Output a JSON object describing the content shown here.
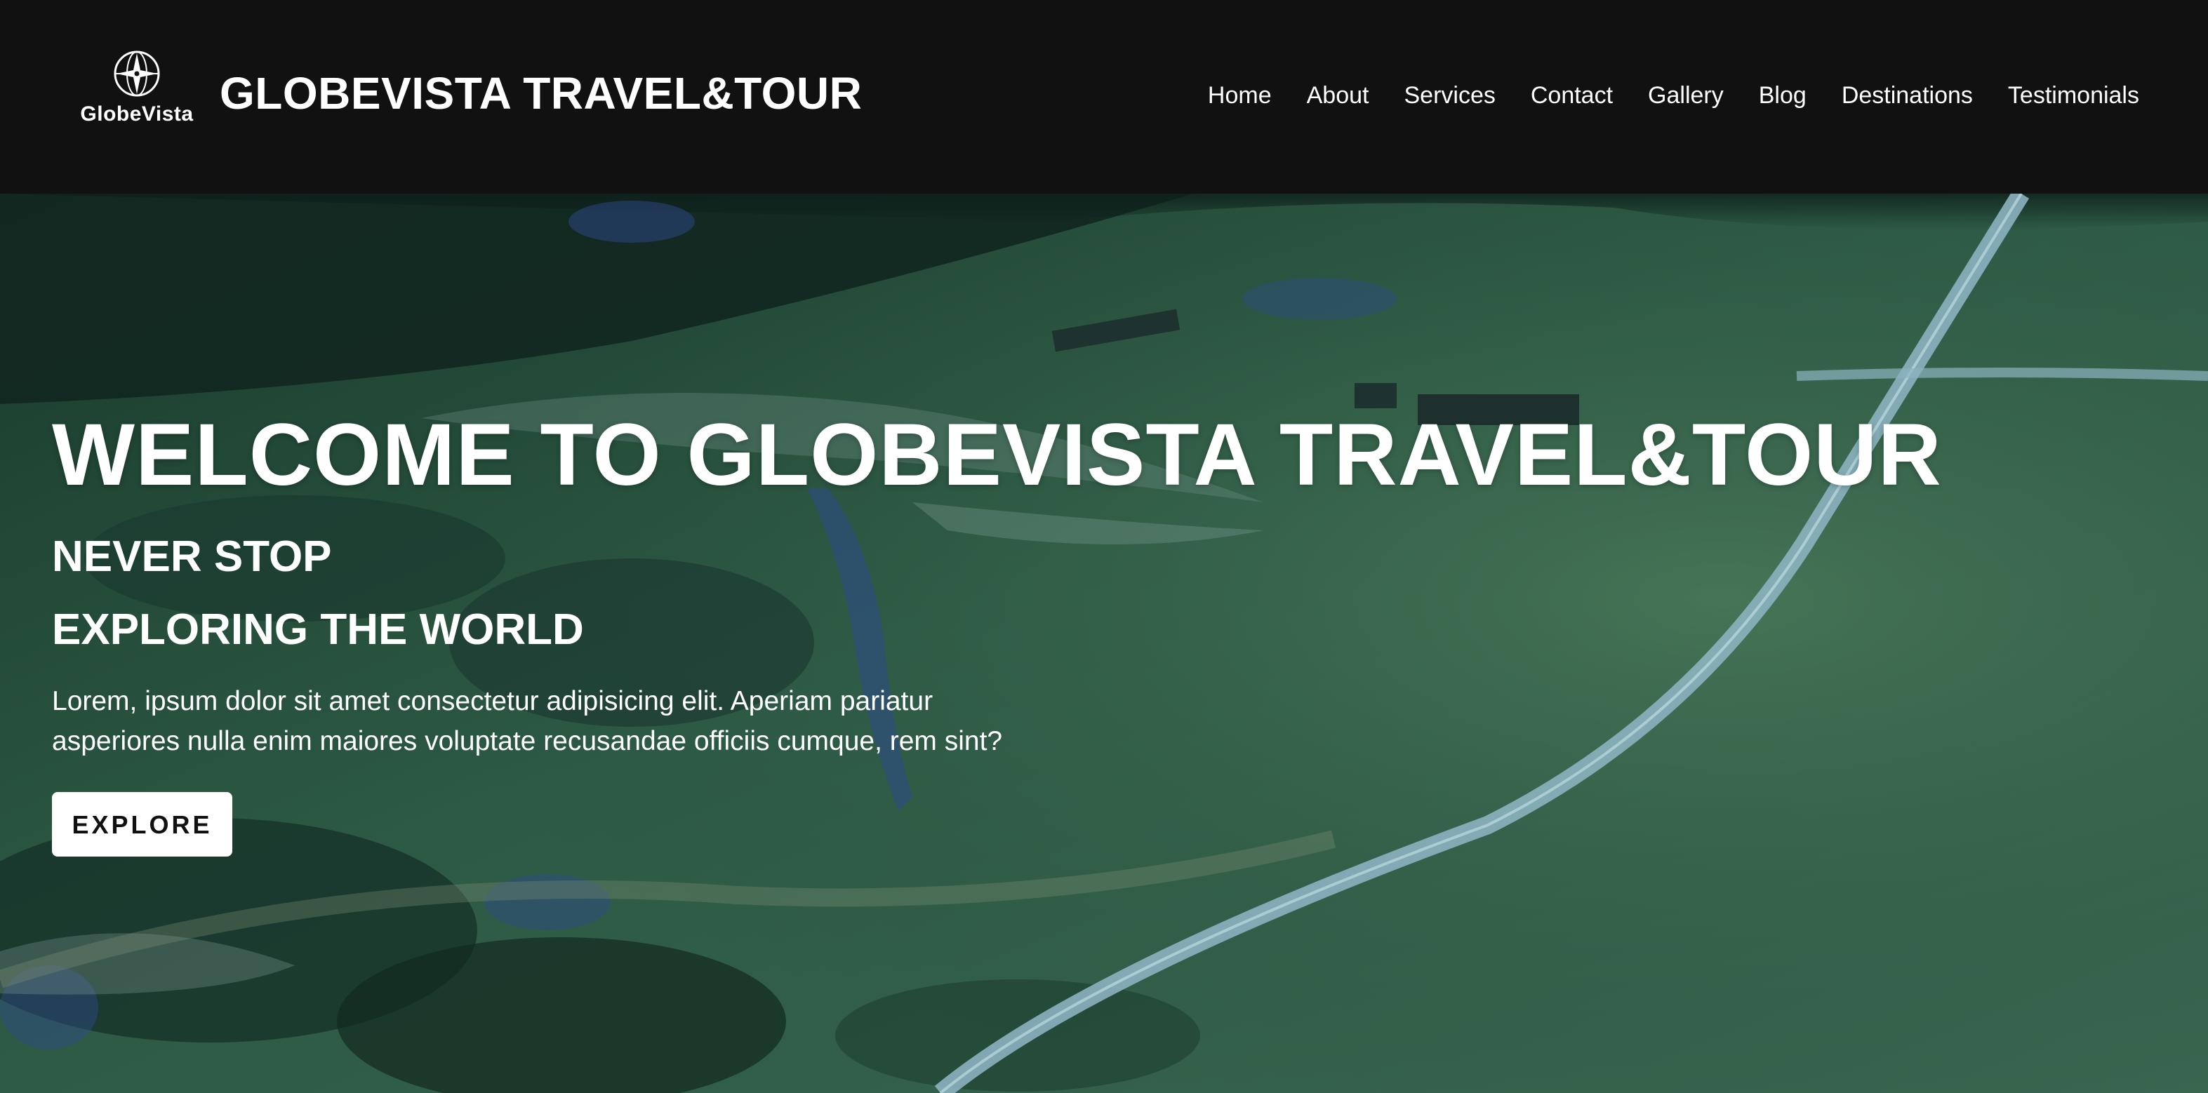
{
  "header": {
    "logo_text": "GlobeVista",
    "brand_title": "GLOBEVISTA TRAVEL&TOUR",
    "nav": [
      {
        "label": "Home"
      },
      {
        "label": "About"
      },
      {
        "label": "Services"
      },
      {
        "label": "Contact"
      },
      {
        "label": "Gallery"
      },
      {
        "label": "Blog"
      },
      {
        "label": "Destinations"
      },
      {
        "label": "Testimonials"
      }
    ]
  },
  "hero": {
    "title": "WELCOME TO GLOBEVISTA TRAVEL&TOUR",
    "subtitle_line1": "NEVER STOP",
    "subtitle_line2": "EXPLORING THE WORLD",
    "description": "Lorem, ipsum dolor sit amet consectetur adipisicing elit. Aperiam pariatur asperiores nulla enim maiores voluptate recusandae officiis cumque, rem sint?",
    "button_label": "EXPLORE",
    "background": "aerial-landscape-image"
  },
  "colors": {
    "header_bg": "#111111",
    "text": "#ffffff",
    "button_bg": "#ffffff",
    "button_text": "#111111"
  },
  "icons": [
    "globe-compass-logo-icon"
  ]
}
